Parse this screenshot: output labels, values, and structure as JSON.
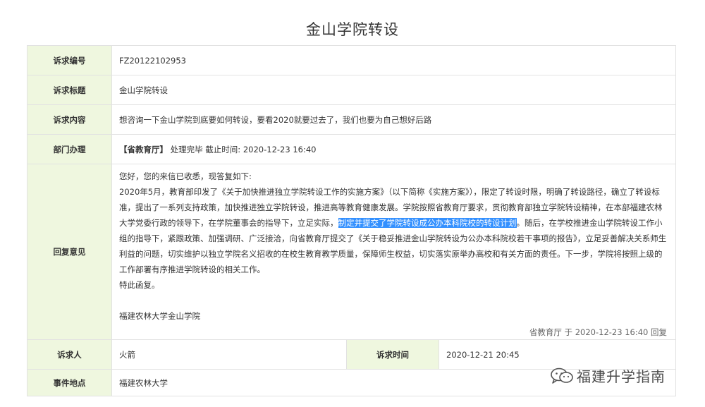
{
  "page": {
    "title": "金山学院转设"
  },
  "rows": {
    "id": {
      "label": "诉求编号",
      "value": "FZ20122102953"
    },
    "title": {
      "label": "诉求标题",
      "value": "金山学院转设"
    },
    "content": {
      "label": "诉求内容",
      "value": "想咨询一下金山学院到底要如何转设，要看2020就要过去了，我们也要为自己想好后路"
    },
    "dept": {
      "label": "部门办理",
      "dept_name": "【省教育厅】",
      "status": "处理完毕 截止时间: 2020-12-23 16:40"
    },
    "reply": {
      "label": "回复意见",
      "greeting": "您好，您的来信已收悉，现答复如下:",
      "para_before": "2020年5月，教育部印发了《关于加快推进独立学院转设工作的实施方案》（以下简称《实施方案》），限定了转设时限，明确了转设路径，确立了转设标准，提出了一系列支持政策，加快推进独立学院转设，推进高等教育健康发展。学院按照省教育厅要求，贯彻教育部独立学院转设精神，在本部福建农林大学党委行政的领导下，在学院董事会的指导下，立足实际，",
      "para_highlight": "制定并提交了学院转设成公办本科院校的转设计划",
      "para_after": "。随后，在学校推进金山学院转设工作小组的指导下，紧跟政策、加强调研、广泛接洽，向省教育厅提交了《关于稳妥推进金山学院转设为公办本科院校若干事项的报告》，立足妥善解决关系师生利益的问题，切实维护以独立学院名义招收的在校生教育教学质量，保障师生权益，切实落实原举办高校和有关方面的责任。下一步，学院将按照上级的工作部署有序推进学院转设的相关工作。",
      "closing": "特此函复。",
      "signature": "福建农林大学金山学院",
      "meta": "省教育厅 于 2020-12-23 16:40 回复"
    },
    "petitioner": {
      "label": "诉求人",
      "value": "火箭",
      "time_label": "诉求时间",
      "time_value": "2020-12-21 20:45"
    },
    "location": {
      "label": "事件地点",
      "value": "福建农林大学"
    }
  },
  "watermark": {
    "text": "福建升学指南",
    "icon": "wechat-icon"
  },
  "colors": {
    "label_bg": "#eff7df",
    "label_text": "#3a8d1f",
    "highlight": "#3390ff",
    "border": "#e2e2e2"
  }
}
